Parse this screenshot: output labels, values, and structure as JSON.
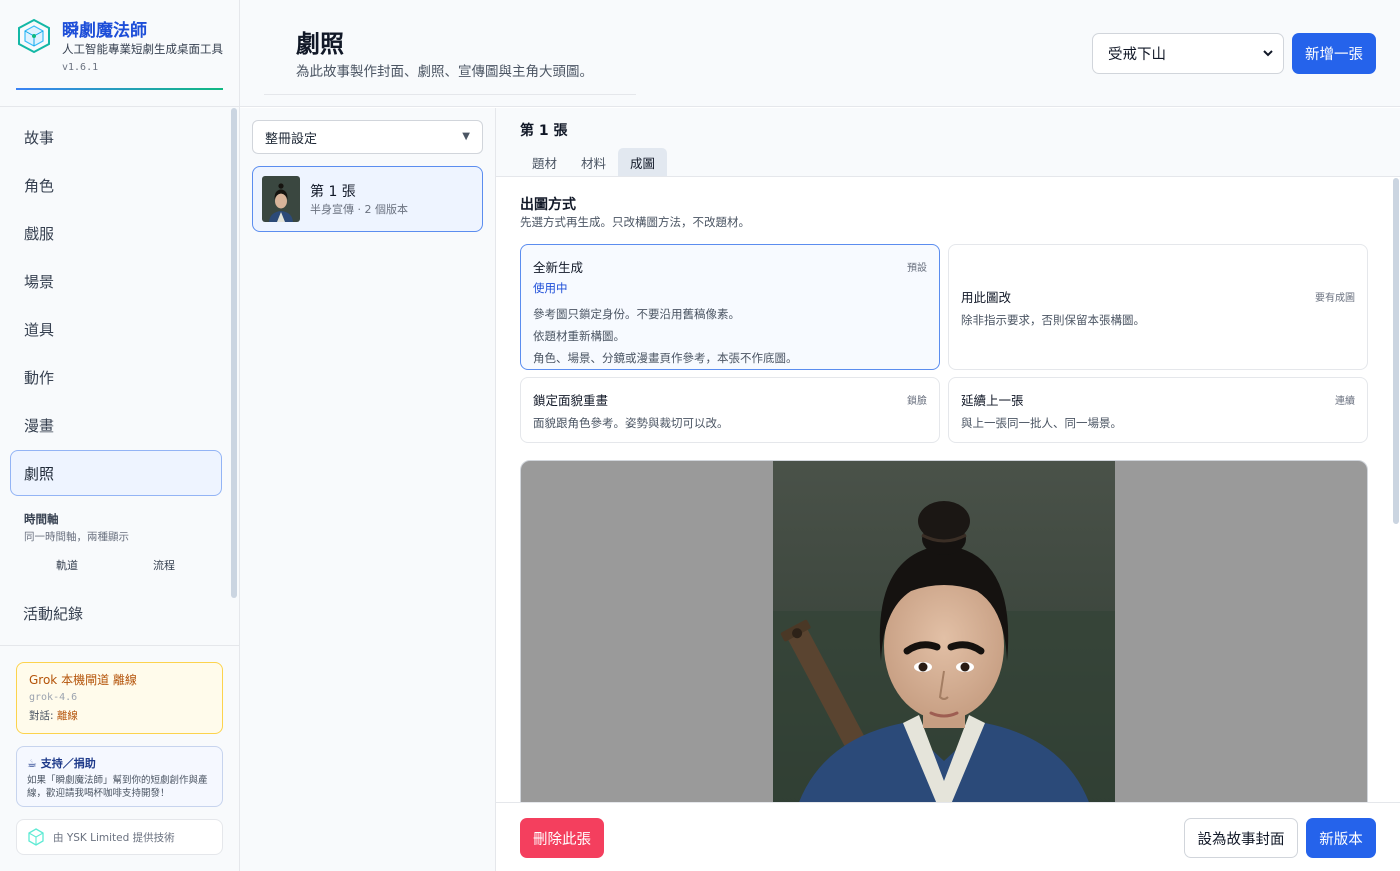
{
  "app": {
    "name": "瞬劇魔法師",
    "tagline": "人工智能專業短劇生成桌面工具",
    "version": "v1.6.1"
  },
  "sidebar": {
    "items": [
      {
        "label": "故事"
      },
      {
        "label": "角色"
      },
      {
        "label": "戲服"
      },
      {
        "label": "場景"
      },
      {
        "label": "道具"
      },
      {
        "label": "動作"
      },
      {
        "label": "漫畫"
      },
      {
        "label": "劇照",
        "active": true
      }
    ],
    "timeline": {
      "title": "時間軸",
      "subtitle": "同一時間軸，兩種顯示",
      "options": [
        "軌道",
        "流程"
      ]
    },
    "log_label": "活動紀錄",
    "grok": {
      "title": "Grok 本機閘道 離線",
      "model": "grok-4.6",
      "chat_label": "對話:",
      "chat_status": "離線"
    },
    "support": {
      "icon": "coffee-icon",
      "title": "☕ 支持／捐助",
      "text": "如果「瞬劇魔法師」幫到你的短劇創作與產線，歡迎請我喝杯咖啡支持開發！"
    },
    "provider": "由 YSK Limited 提供技術"
  },
  "header": {
    "title": "劇照",
    "description": "為此故事製作封面、劇照、宣傳圖與主角大頭圖。",
    "story_select": "受戒下山",
    "add_button": "新增一張"
  },
  "shot_list": {
    "batch_select": "整冊設定",
    "items": [
      {
        "title": "第 1 張",
        "meta": "半身宣傳 · 2 個版本"
      }
    ]
  },
  "editor": {
    "heading": "第 1 張",
    "tabs": [
      {
        "label": "題材"
      },
      {
        "label": "材料"
      },
      {
        "label": "成圖",
        "active": true
      }
    ],
    "section_title": "出圖方式",
    "section_desc": "先選方式再生成。只改構圖方法，不改題材。",
    "options": [
      {
        "title": "全新生成",
        "tag": "預設",
        "status": "使用中",
        "lines": [
          "參考圖只鎖定身份。不要沿用舊稿像素。",
          "依題材重新構圖。",
          "角色、場景、分鏡或漫畫頁作參考，本張不作底圖。"
        ]
      },
      {
        "title": "用此圖改",
        "tag": "要有成圖",
        "lines": [
          "除非指示要求，否則保留本張構圖。"
        ]
      },
      {
        "title": "鎖定面貌重畫",
        "tag": "鎖臉",
        "lines": [
          "面貌跟角色參考。姿勢與裁切可以改。"
        ]
      },
      {
        "title": "延續上一張",
        "tag": "連續",
        "lines": [
          "與上一張同一批人、同一場景。"
        ]
      }
    ],
    "footer": {
      "delete_button": "刪除此張",
      "set_cover_button": "設為故事封面",
      "new_version_button": "新版本"
    }
  },
  "colors": {
    "accent": "#2563eb",
    "danger": "#f43f5e",
    "warning_bg": "#fffbeb",
    "warning_text": "#b45309"
  }
}
